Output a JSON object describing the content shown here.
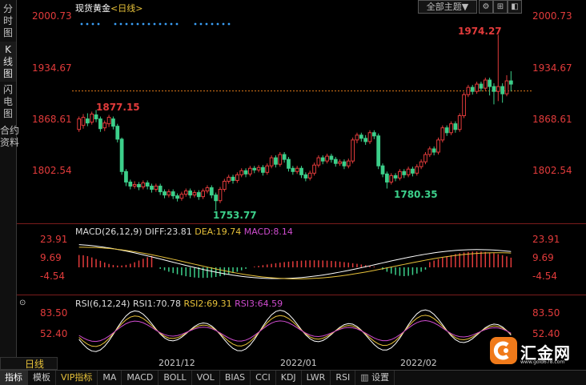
{
  "sidebar": {
    "tabs": [
      {
        "label": "分时图",
        "active": false
      },
      {
        "label": "K线图",
        "active": true
      },
      {
        "label": "闪电图",
        "active": false
      },
      {
        "label": "合约资料",
        "active": false
      }
    ]
  },
  "header": {
    "title": "现货黄金",
    "timeframe": "<日线>",
    "theme_button": "全部主题▼",
    "icon_buttons": [
      "settings-icon",
      "pin-icon"
    ]
  },
  "price_axis": {
    "left": [
      "2000.73",
      "1934.67",
      "1868.61",
      "1802.54"
    ],
    "right": [
      "2000.73",
      "1934.67",
      "1868.61",
      "1802.54"
    ]
  },
  "annotations": {
    "high_left": "1877.15",
    "high_right": "1974.27",
    "low_mid": "1753.77",
    "low_right": "1780.35"
  },
  "macd": {
    "label": "MACD(26,12,9)",
    "diff": "DIFF:23.81",
    "dea": "DEA:19.74",
    "macd": "MACD:8.14",
    "axis": [
      "23.91",
      "9.69",
      "-4.54"
    ]
  },
  "rsi": {
    "label": "RSI(6,12,24)",
    "rsi1": "RSI1:70.78",
    "rsi2": "RSI2:69.31",
    "rsi3": "RSI3:64.59",
    "axis": [
      "83.50",
      "52.40"
    ]
  },
  "period": "日线",
  "dates": [
    "2021/12",
    "2022/01",
    "2022/02"
  ],
  "bottom_tabs": [
    "指标",
    "模板",
    "VIP指标",
    "MA",
    "MACD",
    "BOLL",
    "VOL",
    "BIAS",
    "CCI",
    "KDJ",
    "LWR",
    "RSI",
    "设置"
  ],
  "logo": {
    "name": "汇金网",
    "site": "www.gold678.com"
  },
  "chart_data": {
    "type": "candlestick",
    "ylim": [
      1740,
      2005
    ],
    "candles": [
      [
        1853,
        1866,
        1850,
        1869
      ],
      [
        1858,
        1868,
        1854,
        1872
      ],
      [
        1866,
        1861,
        1857,
        1873
      ],
      [
        1862,
        1872,
        1859,
        1875
      ],
      [
        1871,
        1866,
        1862,
        1877
      ],
      [
        1866,
        1854,
        1850,
        1869
      ],
      [
        1855,
        1861,
        1851,
        1864
      ],
      [
        1860,
        1868,
        1856,
        1871
      ],
      [
        1866,
        1857,
        1853,
        1869
      ],
      [
        1857,
        1841,
        1837,
        1860
      ],
      [
        1841,
        1801,
        1797,
        1843
      ],
      [
        1801,
        1788,
        1783,
        1804
      ],
      [
        1788,
        1783,
        1779,
        1791
      ],
      [
        1783,
        1785,
        1780,
        1789
      ],
      [
        1785,
        1782,
        1778,
        1788
      ],
      [
        1782,
        1787,
        1779,
        1790
      ],
      [
        1787,
        1783,
        1779,
        1790
      ],
      [
        1783,
        1779,
        1775,
        1786
      ],
      [
        1779,
        1783,
        1776,
        1786
      ],
      [
        1783,
        1776,
        1772,
        1786
      ],
      [
        1776,
        1772,
        1768,
        1779
      ],
      [
        1772,
        1776,
        1769,
        1779
      ],
      [
        1776,
        1771,
        1767,
        1779
      ],
      [
        1771,
        1768,
        1764,
        1774
      ],
      [
        1768,
        1773,
        1765,
        1776
      ],
      [
        1773,
        1777,
        1770,
        1780
      ],
      [
        1777,
        1772,
        1768,
        1780
      ],
      [
        1772,
        1775,
        1769,
        1778
      ],
      [
        1775,
        1770,
        1766,
        1778
      ],
      [
        1770,
        1777,
        1767,
        1780
      ],
      [
        1777,
        1781,
        1774,
        1784
      ],
      [
        1781,
        1772,
        1768,
        1784
      ],
      [
        1772,
        1765,
        1753,
        1775
      ],
      [
        1765,
        1779,
        1762,
        1782
      ],
      [
        1779,
        1789,
        1776,
        1792
      ],
      [
        1789,
        1794,
        1786,
        1797
      ],
      [
        1794,
        1790,
        1786,
        1797
      ],
      [
        1790,
        1797,
        1787,
        1800
      ],
      [
        1797,
        1802,
        1794,
        1805
      ],
      [
        1802,
        1798,
        1794,
        1805
      ],
      [
        1798,
        1805,
        1795,
        1808
      ],
      [
        1805,
        1803,
        1799,
        1808
      ],
      [
        1803,
        1806,
        1800,
        1809
      ],
      [
        1806,
        1800,
        1796,
        1809
      ],
      [
        1800,
        1808,
        1797,
        1811
      ],
      [
        1808,
        1818,
        1805,
        1821
      ],
      [
        1818,
        1810,
        1806,
        1821
      ],
      [
        1810,
        1822,
        1807,
        1825
      ],
      [
        1822,
        1816,
        1812,
        1825
      ],
      [
        1816,
        1805,
        1801,
        1819
      ],
      [
        1805,
        1801,
        1797,
        1808
      ],
      [
        1801,
        1805,
        1798,
        1808
      ],
      [
        1805,
        1797,
        1793,
        1808
      ],
      [
        1797,
        1793,
        1789,
        1800
      ],
      [
        1793,
        1799,
        1790,
        1802
      ],
      [
        1799,
        1809,
        1796,
        1812
      ],
      [
        1809,
        1818,
        1806,
        1821
      ],
      [
        1818,
        1814,
        1810,
        1821
      ],
      [
        1814,
        1820,
        1811,
        1823
      ],
      [
        1820,
        1816,
        1812,
        1823
      ],
      [
        1816,
        1811,
        1807,
        1819
      ],
      [
        1811,
        1813,
        1808,
        1816
      ],
      [
        1813,
        1808,
        1804,
        1816
      ],
      [
        1808,
        1814,
        1805,
        1817
      ],
      [
        1814,
        1840,
        1811,
        1843
      ],
      [
        1840,
        1846,
        1836,
        1849
      ],
      [
        1846,
        1842,
        1838,
        1849
      ],
      [
        1842,
        1838,
        1834,
        1846
      ],
      [
        1838,
        1849,
        1835,
        1852
      ],
      [
        1849,
        1845,
        1841,
        1852
      ],
      [
        1845,
        1808,
        1804,
        1848
      ],
      [
        1808,
        1798,
        1794,
        1811
      ],
      [
        1798,
        1788,
        1780,
        1801
      ],
      [
        1788,
        1796,
        1785,
        1799
      ],
      [
        1796,
        1793,
        1789,
        1799
      ],
      [
        1793,
        1801,
        1790,
        1804
      ],
      [
        1801,
        1797,
        1793,
        1804
      ],
      [
        1797,
        1804,
        1794,
        1807
      ],
      [
        1804,
        1799,
        1795,
        1807
      ],
      [
        1799,
        1807,
        1796,
        1810
      ],
      [
        1807,
        1813,
        1804,
        1816
      ],
      [
        1813,
        1822,
        1810,
        1825
      ],
      [
        1822,
        1829,
        1819,
        1832
      ],
      [
        1829,
        1825,
        1821,
        1832
      ],
      [
        1825,
        1840,
        1822,
        1843
      ],
      [
        1840,
        1855,
        1837,
        1858
      ],
      [
        1855,
        1849,
        1845,
        1858
      ],
      [
        1849,
        1860,
        1846,
        1863
      ],
      [
        1860,
        1853,
        1849,
        1863
      ],
      [
        1853,
        1870,
        1850,
        1873
      ],
      [
        1870,
        1896,
        1867,
        1899
      ],
      [
        1896,
        1905,
        1893,
        1908
      ],
      [
        1905,
        1900,
        1896,
        1908
      ],
      [
        1900,
        1909,
        1897,
        1912
      ],
      [
        1909,
        1904,
        1900,
        1912
      ],
      [
        1904,
        1914,
        1901,
        1917
      ],
      [
        1914,
        1906,
        1895,
        1917
      ],
      [
        1906,
        1900,
        1884,
        1910
      ],
      [
        1900,
        1906,
        1888,
        1970
      ],
      [
        1906,
        1897,
        1886,
        1910
      ],
      [
        1897,
        1913,
        1894,
        1920
      ],
      [
        1913,
        1909,
        1900,
        1925
      ]
    ]
  }
}
